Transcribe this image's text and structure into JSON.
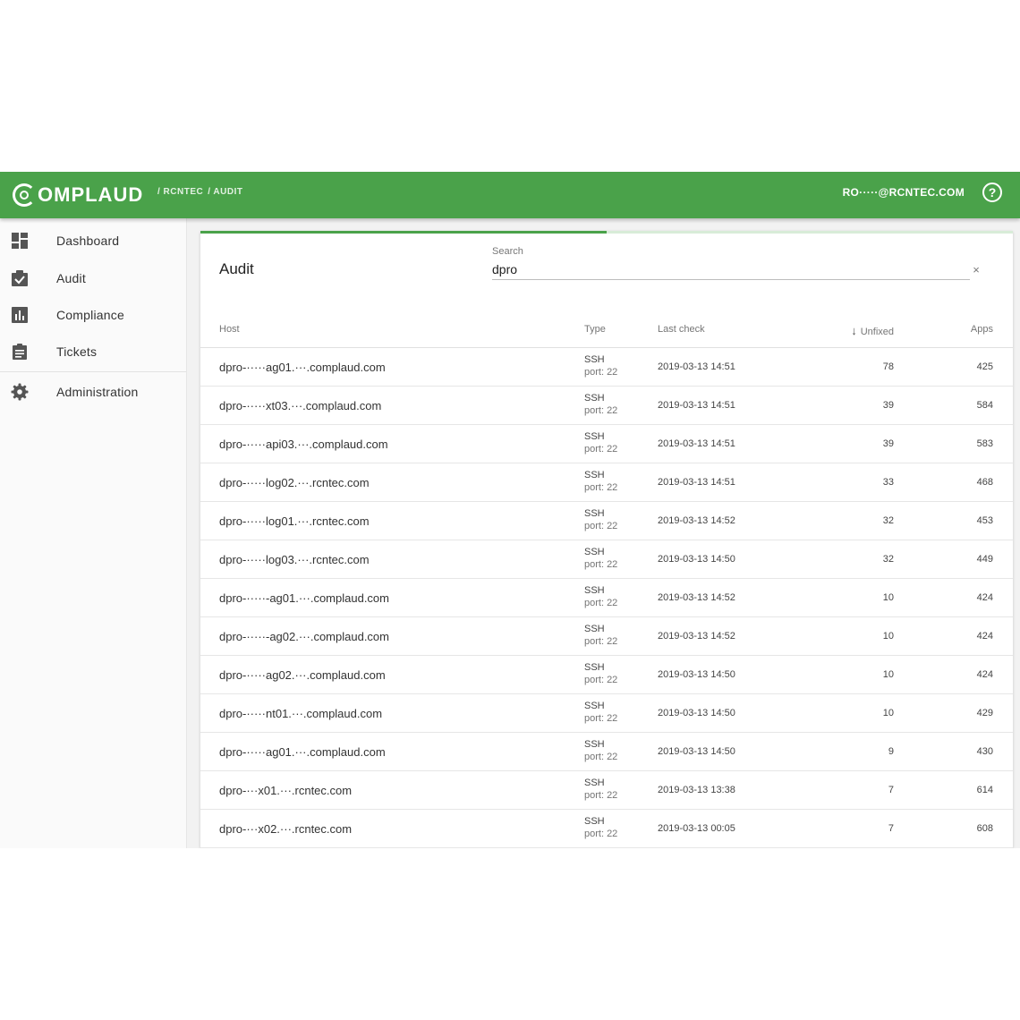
{
  "app": {
    "logo_text": "OMPLAUD",
    "breadcrumb": [
      "/ RCNTEC",
      "/ AUDIT"
    ],
    "user": "RO·····@RCNTEC.COM",
    "help_glyph": "?"
  },
  "colors": {
    "brand": "#4aa24a",
    "sidebar_bg": "#fafafa",
    "card_bg": "#ffffff"
  },
  "sidebar": {
    "items": [
      {
        "label": "Dashboard",
        "icon": "dashboard-icon"
      },
      {
        "label": "Audit",
        "icon": "audit-clipboard-icon"
      },
      {
        "label": "Compliance",
        "icon": "bar-chart-icon"
      },
      {
        "label": "Tickets",
        "icon": "tickets-icon"
      },
      {
        "label": "Administration",
        "icon": "gear-icon"
      }
    ]
  },
  "main": {
    "title": "Audit",
    "search": {
      "label": "Search",
      "value": "dpro",
      "clear_glyph": "×"
    },
    "columns": {
      "host": "Host",
      "type": "Type",
      "last_check": "Last check",
      "unfixed": "Unfixed",
      "apps": "Apps"
    },
    "sort_glyph": "↓",
    "progress": 0.5,
    "rows": [
      {
        "host": "dpro-·····ag01.···.complaud.com",
        "type": "SSH",
        "port": "port: 22",
        "last_check": "2019-03-13 14:51",
        "unfixed": "78",
        "apps": "425"
      },
      {
        "host": "dpro-·····xt03.···.complaud.com",
        "type": "SSH",
        "port": "port: 22",
        "last_check": "2019-03-13 14:51",
        "unfixed": "39",
        "apps": "584"
      },
      {
        "host": "dpro-·····api03.···.complaud.com",
        "type": "SSH",
        "port": "port: 22",
        "last_check": "2019-03-13 14:51",
        "unfixed": "39",
        "apps": "583"
      },
      {
        "host": "dpro-·····log02.···.rcntec.com",
        "type": "SSH",
        "port": "port: 22",
        "last_check": "2019-03-13 14:51",
        "unfixed": "33",
        "apps": "468"
      },
      {
        "host": "dpro-·····log01.···.rcntec.com",
        "type": "SSH",
        "port": "port: 22",
        "last_check": "2019-03-13 14:52",
        "unfixed": "32",
        "apps": "453"
      },
      {
        "host": "dpro-·····log03.···.rcntec.com",
        "type": "SSH",
        "port": "port: 22",
        "last_check": "2019-03-13 14:50",
        "unfixed": "32",
        "apps": "449"
      },
      {
        "host": "dpro-·····-ag01.···.complaud.com",
        "type": "SSH",
        "port": "port: 22",
        "last_check": "2019-03-13 14:52",
        "unfixed": "10",
        "apps": "424"
      },
      {
        "host": "dpro-·····-ag02.···.complaud.com",
        "type": "SSH",
        "port": "port: 22",
        "last_check": "2019-03-13 14:52",
        "unfixed": "10",
        "apps": "424"
      },
      {
        "host": "dpro-·····ag02.···.complaud.com",
        "type": "SSH",
        "port": "port: 22",
        "last_check": "2019-03-13 14:50",
        "unfixed": "10",
        "apps": "424"
      },
      {
        "host": "dpro-·····nt01.···.complaud.com",
        "type": "SSH",
        "port": "port: 22",
        "last_check": "2019-03-13 14:50",
        "unfixed": "10",
        "apps": "429"
      },
      {
        "host": "dpro-·····ag01.···.complaud.com",
        "type": "SSH",
        "port": "port: 22",
        "last_check": "2019-03-13 14:50",
        "unfixed": "9",
        "apps": "430"
      },
      {
        "host": "dpro-···x01.···.rcntec.com",
        "type": "SSH",
        "port": "port: 22",
        "last_check": "2019-03-13 13:38",
        "unfixed": "7",
        "apps": "614"
      },
      {
        "host": "dpro-···x02.···.rcntec.com",
        "type": "SSH",
        "port": "port: 22",
        "last_check": "2019-03-13 00:05",
        "unfixed": "7",
        "apps": "608"
      }
    ]
  }
}
